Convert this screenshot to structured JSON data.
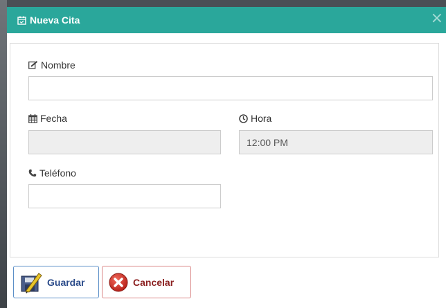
{
  "modal": {
    "title": "Nueva Cita",
    "title_icon": "calendar-check-icon",
    "close_label": "×"
  },
  "form": {
    "nombre": {
      "label": "Nombre",
      "icon": "edit-icon",
      "value": ""
    },
    "fecha": {
      "label": "Fecha",
      "icon": "calendar-icon",
      "value": ""
    },
    "hora": {
      "label": "Hora",
      "icon": "clock-icon",
      "value": "12:00 PM"
    },
    "telefono": {
      "label": "Teléfono",
      "icon": "phone-icon",
      "value": ""
    }
  },
  "footer": {
    "save_label": "Guardar",
    "cancel_label": "Cancelar"
  },
  "colors": {
    "header": "#2aa79b",
    "save_border": "#5b8fc7",
    "cancel_border": "#d98484",
    "cancel_icon": "#d9342b"
  }
}
